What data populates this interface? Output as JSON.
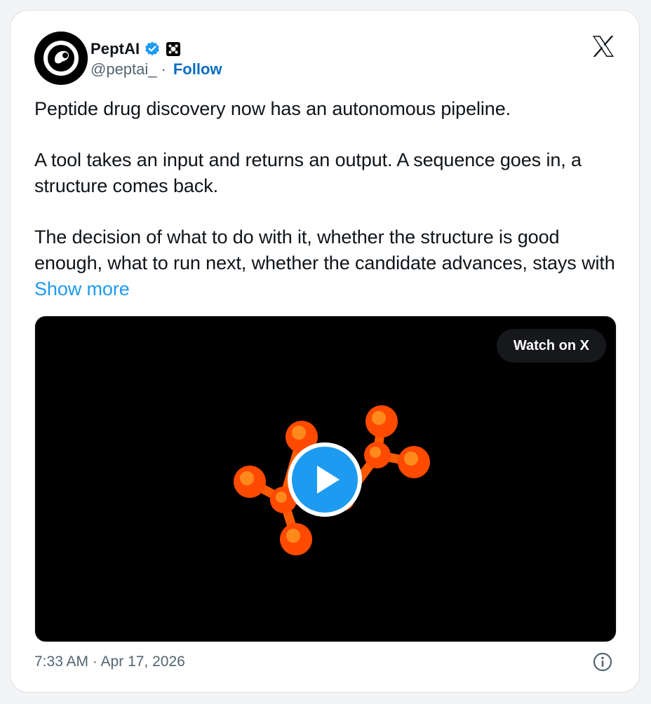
{
  "author": {
    "display_name": "PeptAI",
    "handle": "@peptai_",
    "separator": "·",
    "follow_label": "Follow",
    "verified_icon": "verified-badge-icon",
    "affiliate_icon": "affiliate-badge-icon",
    "avatar_icon": "peptai-logo-icon"
  },
  "tweet": {
    "paragraph_1": "Peptide drug discovery now has an autonomous pipeline.",
    "paragraph_2": "A tool takes an input and returns an output. A sequence goes in, a structure comes back.",
    "paragraph_3": "The decision of what to do with it, whether the structure is good enough, what to run next, whether the candidate advances, stays with",
    "show_more": "Show more"
  },
  "media": {
    "watch_label": "Watch on X",
    "play_icon": "play-icon"
  },
  "footer": {
    "timestamp": "7:33 AM · Apr 17, 2026",
    "info_icon": "info-icon"
  },
  "colors": {
    "link_blue": "#1d9bf0",
    "follow_blue": "#0a6fc2",
    "verified_blue": "#1d9bf0",
    "text": "#0f1419",
    "muted": "#536471",
    "molecule_orange": "#ff5a00"
  }
}
